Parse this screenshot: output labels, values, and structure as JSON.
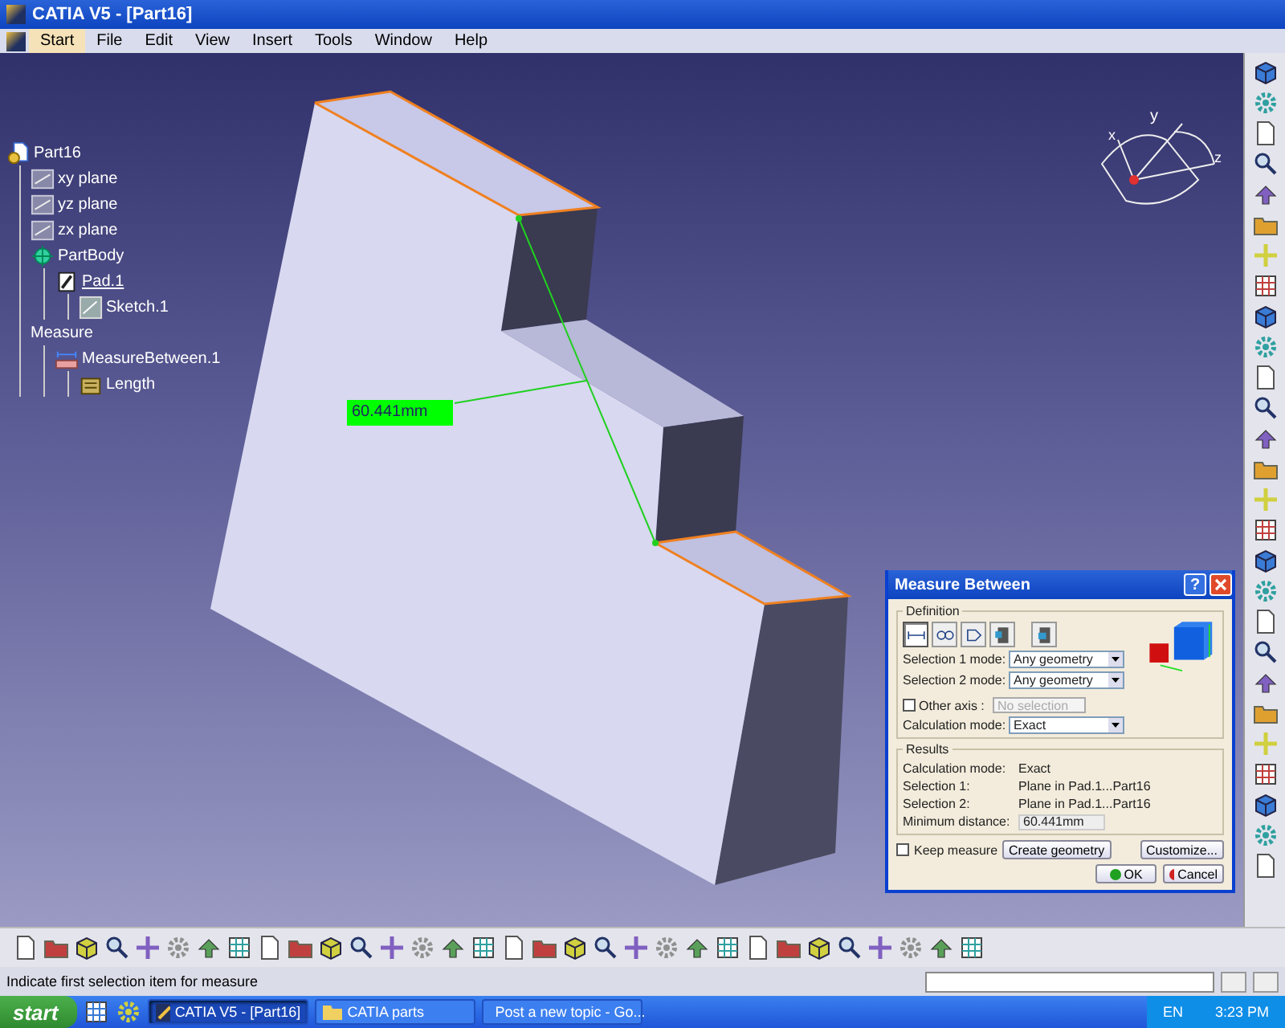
{
  "window": {
    "title": "CATIA V5 - [Part16]"
  },
  "dialog_help": "?",
  "menu": [
    {
      "label": "Start",
      "selected": true
    },
    {
      "label": "File",
      "selected": false
    },
    {
      "label": "Edit",
      "selected": false
    },
    {
      "label": "View",
      "selected": false
    },
    {
      "label": "Insert",
      "selected": false
    },
    {
      "label": "Tools",
      "selected": false
    },
    {
      "label": "Window",
      "selected": false
    },
    {
      "label": "Help",
      "selected": false
    }
  ],
  "tree": [
    {
      "label": "Part16",
      "kind": "part",
      "in_work": false,
      "children": [
        {
          "label": "xy plane",
          "kind": "plane",
          "in_work": false
        },
        {
          "label": "yz plane",
          "kind": "plane",
          "in_work": false
        },
        {
          "label": "zx plane",
          "kind": "plane",
          "in_work": false
        },
        {
          "label": "PartBody",
          "kind": "body",
          "in_work": false,
          "children": [
            {
              "label": "Pad.1",
              "kind": "pad",
              "in_work": true,
              "children": [
                {
                  "label": "Sketch.1",
                  "kind": "sketch",
                  "in_work": false
                }
              ]
            }
          ]
        },
        {
          "label": "Measure",
          "kind": "set",
          "in_work": false,
          "children": [
            {
              "label": "MeasureBetween.1",
              "kind": "measure",
              "in_work": false,
              "children": [
                {
                  "label": "Length",
                  "kind": "length",
                  "in_work": false
                }
              ]
            }
          ]
        }
      ]
    }
  ],
  "measure_label": "60.441mm",
  "compass": {
    "axes": [
      "y",
      "x",
      "z"
    ]
  },
  "dialog": {
    "title": "Measure Between",
    "definition": {
      "title": "Definition",
      "modes": [
        {
          "selected": true
        },
        {
          "selected": false
        },
        {
          "selected": false
        },
        {
          "selected": false
        },
        {
          "selected": false
        }
      ],
      "selection_1": {
        "label": "Selection 1 mode:",
        "value": "Any geometry"
      },
      "selection_2": {
        "label": "Selection 2 mode:",
        "value": "Any geometry"
      },
      "other_axis": {
        "label": "Other axis :",
        "checked": false,
        "placeholder": "No selection"
      },
      "calculation": {
        "label": "Calculation mode:",
        "value": "Exact"
      }
    },
    "results": {
      "title": "Results",
      "rows": [
        {
          "label": "Calculation mode:",
          "value": "Exact"
        },
        {
          "label": "Selection 1:",
          "value": "Plane in Pad.1...Part16"
        },
        {
          "label": "Selection 2:",
          "value": "Plane in Pad.1...Part16"
        }
      ],
      "minimum": {
        "label": "Minimum distance:",
        "value": "60.441mm"
      }
    },
    "keep_measure": {
      "label": "Keep measure",
      "checked": false
    },
    "buttons": {
      "create": "Create geometry",
      "customize": "Customize...",
      "ok": "OK",
      "cancel": "Cancel"
    }
  },
  "status_bar": {
    "prompt": "Indicate first selection item for measure"
  },
  "taskbar": {
    "start": "start",
    "tasks": [
      {
        "label": "CATIA V5 - [Part16]",
        "kind": "catia",
        "selected": true
      },
      {
        "label": "CATIA parts",
        "kind": "folder",
        "selected": false
      },
      {
        "label": "Post a new topic - Go...",
        "kind": "browser",
        "selected": false
      }
    ],
    "language": "EN",
    "time": "3:23 PM"
  }
}
